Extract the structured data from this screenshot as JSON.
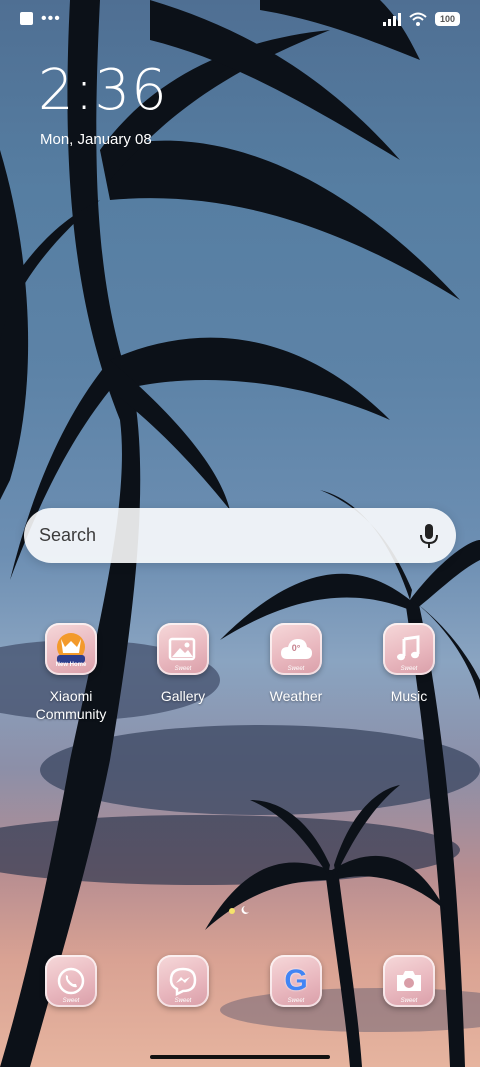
{
  "status_bar": {
    "battery": "100",
    "dots": "•••"
  },
  "lockscreen": {
    "time": "2:36",
    "date": "Mon, January 08"
  },
  "search": {
    "placeholder": "Search"
  },
  "apps": [
    {
      "label": "Xiaomi Community",
      "icon": "xiaomi-community-icon"
    },
    {
      "label": "Gallery",
      "icon": "gallery-icon"
    },
    {
      "label": "Weather",
      "icon": "weather-icon",
      "temp": "0°"
    },
    {
      "label": "Music",
      "icon": "music-icon"
    }
  ],
  "dock": [
    {
      "icon": "phone-icon"
    },
    {
      "icon": "messenger-icon"
    },
    {
      "icon": "google-icon",
      "glyph": "G"
    },
    {
      "icon": "camera-icon"
    }
  ],
  "icon_badge_text": "Sweet",
  "community_badge_text": "New Home"
}
